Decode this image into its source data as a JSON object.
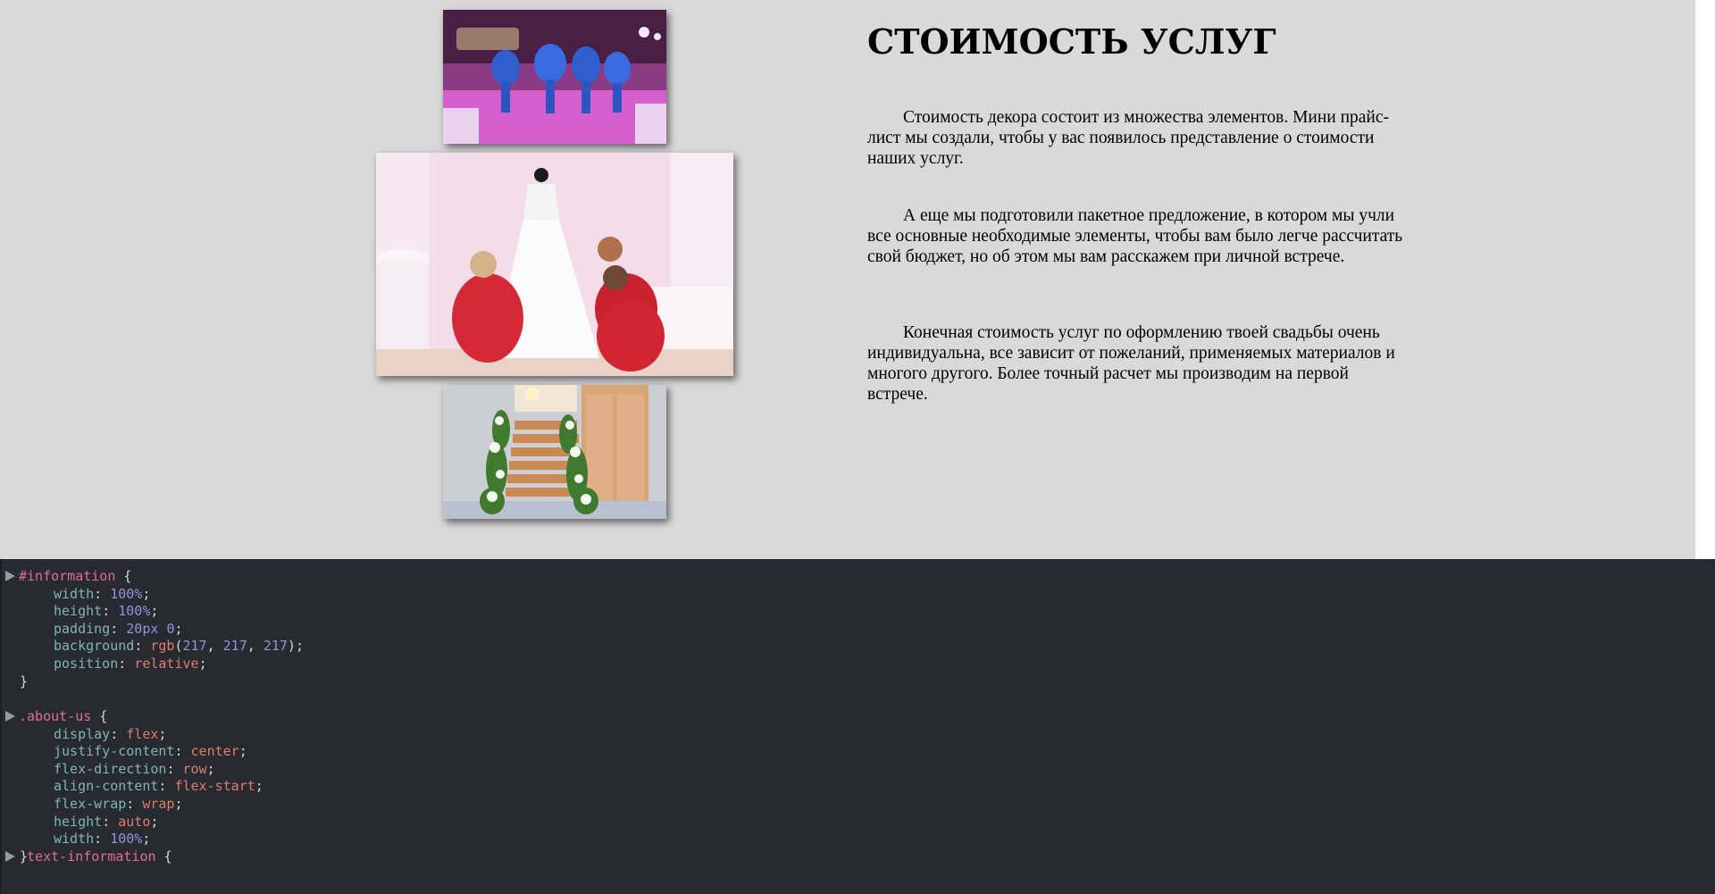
{
  "images": {
    "dancers": {
      "alt": "dancers"
    },
    "dress": {
      "alt": "wedding dress"
    },
    "stairs": {
      "alt": "flower staircase"
    }
  },
  "content": {
    "heading": "СТОИМОСТЬ УСЛУГ",
    "paragraphs": [
      "Стоимость декора состоит из множества элементов. Мини прайс-лист мы создали, чтобы у вас появилось представление о стоимости наших услуг.",
      "А еще мы подготовили пакетное предложение, в котором мы учли все основные необходимые элементы, чтобы вам было легче рассчитать свой бюджет, но об этом мы вам расскажем при личной встрече.",
      "Конечная стоимость услуг по оформлению твоей свадьбы очень индивидуальна, все зависит от пожеланий, применяемых материалов и многого другого. Более точный расчет мы производим на первой встрече."
    ]
  },
  "devtools": {
    "rules": [
      {
        "selector": "#information",
        "declarations": [
          {
            "prop": "width",
            "value": [
              [
                "num",
                "100%"
              ]
            ]
          },
          {
            "prop": "height",
            "value": [
              [
                "num",
                "100%"
              ]
            ]
          },
          {
            "prop": "padding",
            "value": [
              [
                "num",
                "20px"
              ],
              [
                "plain",
                " "
              ],
              [
                "num",
                "0"
              ]
            ]
          },
          {
            "prop": "background",
            "value": [
              [
                "kw",
                "rgb"
              ],
              [
                "plain",
                "("
              ],
              [
                "num",
                "217"
              ],
              [
                "plain",
                ", "
              ],
              [
                "num",
                "217"
              ],
              [
                "plain",
                ", "
              ],
              [
                "num",
                "217"
              ],
              [
                "plain",
                ")"
              ]
            ]
          },
          {
            "prop": "position",
            "value": [
              [
                "kw",
                "relative"
              ]
            ]
          }
        ]
      },
      {
        "selector": ".about-us",
        "declarations": [
          {
            "prop": "display",
            "value": [
              [
                "kw",
                "flex"
              ]
            ]
          },
          {
            "prop": "justify-content",
            "value": [
              [
                "kw",
                "center"
              ]
            ]
          },
          {
            "prop": "flex-direction",
            "value": [
              [
                "kw",
                "row"
              ]
            ]
          },
          {
            "prop": "align-content",
            "value": [
              [
                "kw",
                "flex-start"
              ]
            ]
          },
          {
            "prop": "flex-wrap",
            "value": [
              [
                "kw",
                "wrap"
              ]
            ]
          },
          {
            "prop": "height",
            "value": [
              [
                "kw",
                "auto"
              ]
            ]
          },
          {
            "prop": "width",
            "value": [
              [
                "num",
                "100%"
              ]
            ]
          }
        ]
      },
      {
        "selector": ".text-information",
        "declarations": []
      }
    ]
  },
  "colors": {
    "page_background": "#d9d9d9",
    "devtools_background": "#282a31",
    "selector": "#e06c9a",
    "property": "#7fb6b0",
    "keyword_value": "#e07c6a",
    "number_value": "#9a8fd8"
  }
}
